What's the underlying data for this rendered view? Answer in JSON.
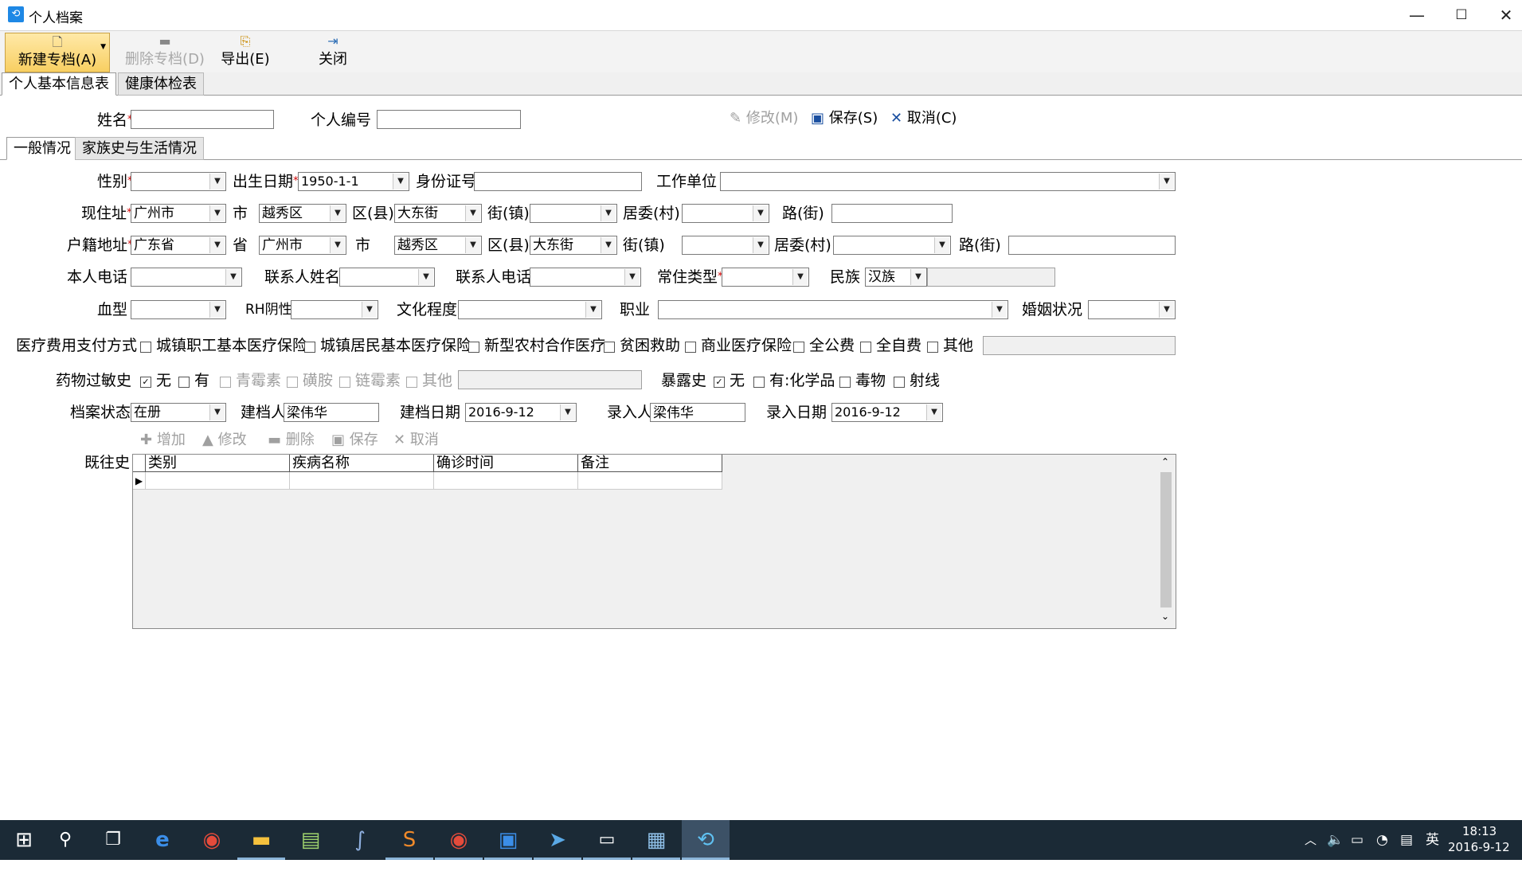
{
  "window": {
    "title": "个人档案",
    "app_icon": "archive-app-icon",
    "min": "—",
    "max": "☐",
    "close": "✕"
  },
  "toolbar": {
    "new_label": "新建专档(A)",
    "delete_label": "删除专档(D)",
    "export_label": "导出(E)",
    "close_label": "关闭"
  },
  "main_tabs": [
    "个人基本信息表",
    "健康体检表"
  ],
  "header": {
    "name_label": "姓名",
    "id_label": "个人编号",
    "edit_label": "修改(M)",
    "save_label": "保存(S)",
    "cancel_label": "取消(C)"
  },
  "sub_tabs": [
    "一般情况",
    "家族史与生活情况"
  ],
  "form": {
    "gender_label": "性别",
    "birth_label": "出生日期",
    "birth_value": "1950-1-1",
    "idcard_label": "身份证号",
    "work_label": "工作单位",
    "addr_label": "现住址",
    "addr_city": "广州市",
    "addr_city_unit": "市",
    "addr_district": "越秀区",
    "addr_district_unit": "区(县)",
    "addr_street": "大东街",
    "addr_street_unit": "街(镇)",
    "addr_village_unit": "居委(村)",
    "addr_road_unit": "路(街)",
    "hukou_label": "户籍地址",
    "hukou_province": "广东省",
    "hukou_province_unit": "省",
    "hukou_city": "广州市",
    "hukou_city_unit": "市",
    "hukou_district": "越秀区",
    "hukou_district_unit": "区(县)",
    "hukou_street": "大东街",
    "hukou_street_unit": "街(镇)",
    "hukou_village_unit": "居委(村)",
    "hukou_road_unit": "路(街)",
    "phone_label": "本人电话",
    "contact_name_label": "联系人姓名",
    "contact_phone_label": "联系人电话",
    "residence_label": "常住类型",
    "ethnic_label": "民族",
    "ethnic_value": "汉族",
    "blood_label": "血型",
    "rh_label": "RH阴性",
    "edu_label": "文化程度",
    "job_label": "职业",
    "marital_label": "婚姻状况",
    "payment_label": "医疗费用支付方式",
    "payment_options": [
      "城镇职工基本医疗保险",
      "城镇居民基本医疗保险",
      "新型农村合作医疗",
      "贫困救助",
      "商业医疗保险",
      "全公费",
      "全自费",
      "其他"
    ],
    "allergy_label": "药物过敏史",
    "allergy_options": [
      "无",
      "有",
      "青霉素",
      "磺胺",
      "链霉素",
      "其他"
    ],
    "exposure_label": "暴露史",
    "exposure_options": [
      "无",
      "有:化学品",
      "毒物",
      "射线"
    ],
    "status_label": "档案状态",
    "status_value": "在册",
    "creator_label": "建档人",
    "creator_value": "梁伟华",
    "create_date_label": "建档日期",
    "create_date_value": "2016-9-12",
    "entry_label": "录入人",
    "entry_value": "梁伟华",
    "entry_date_label": "录入日期",
    "entry_date_value": "2016-9-12"
  },
  "history": {
    "label": "既往史",
    "toolbar": [
      "增加",
      "修改",
      "删除",
      "保存",
      "取消"
    ],
    "columns": [
      "类别",
      "疾病名称",
      "确诊时间",
      "备注"
    ]
  },
  "taskbar": {
    "time": "18:13",
    "date": "2016-9-12",
    "ime": "英",
    "apps": [
      "start-icon",
      "search-icon",
      "task-view-icon",
      "edge-icon",
      "chrome-icon",
      "file-explorer-icon",
      "app-icon",
      "app-icon",
      "sublime-icon",
      "chrome-icon",
      "app-icon",
      "app-icon",
      "terminal-icon",
      "app-icon",
      "archive-app-icon"
    ]
  }
}
